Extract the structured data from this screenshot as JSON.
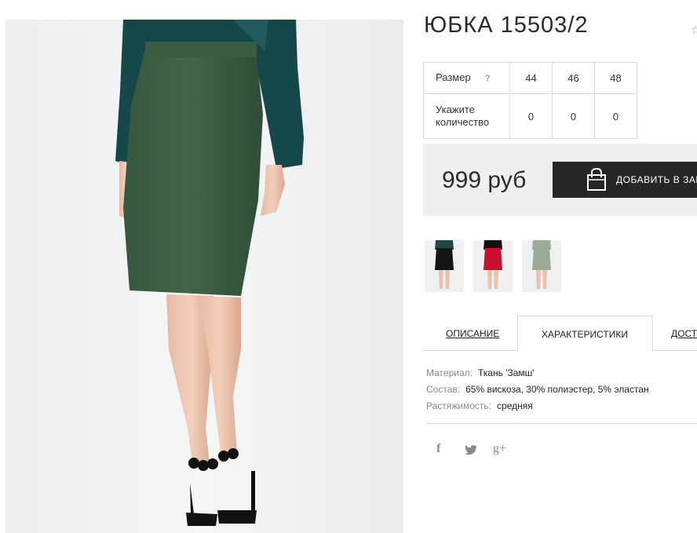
{
  "product": {
    "title": "ЮБКА 15503/2",
    "wishlist_icon": "star-icon"
  },
  "size_table": {
    "size_label": "Размер",
    "help_mark": "?",
    "sizes": [
      "44",
      "46",
      "48"
    ],
    "qty_label": "Укажите количество",
    "quantities": [
      "0",
      "0",
      "0"
    ]
  },
  "purchase": {
    "price": "999 руб",
    "add_to_cart_label": "ДОБАВИТЬ В ЗАКАЗ",
    "cart_icon": "shopping-bag-icon"
  },
  "thumbnails": [
    {
      "name": "black-skirt",
      "skirt_color": "#151515",
      "top_color": "#1d4a44"
    },
    {
      "name": "red-skirt",
      "skirt_color": "#c8102e",
      "top_color": "#111111"
    },
    {
      "name": "sage-skirt",
      "skirt_color": "#9aab97",
      "top_color": "#9aab97"
    }
  ],
  "tabs": {
    "description": "ОПИСАНИЕ",
    "characteristics": "ХАРАКТЕРИСТИКИ",
    "delivery": "ДОСТАВКА",
    "active": "characteristics"
  },
  "specs": [
    {
      "key": "Материал:",
      "value": "Ткань 'Замш'"
    },
    {
      "key": "Состав:",
      "value": "65% вискоза, 30% полиэстер, 5% эластан"
    },
    {
      "key": "Растяжимость:",
      "value": "средняя"
    }
  ],
  "social": {
    "facebook": "f",
    "twitter": "twitter-icon",
    "google_plus": "g+"
  },
  "colors": {
    "skirt": "#3d5e45",
    "blouse": "#16484a",
    "button_bg": "#272727",
    "price_box_bg": "#efefef"
  }
}
